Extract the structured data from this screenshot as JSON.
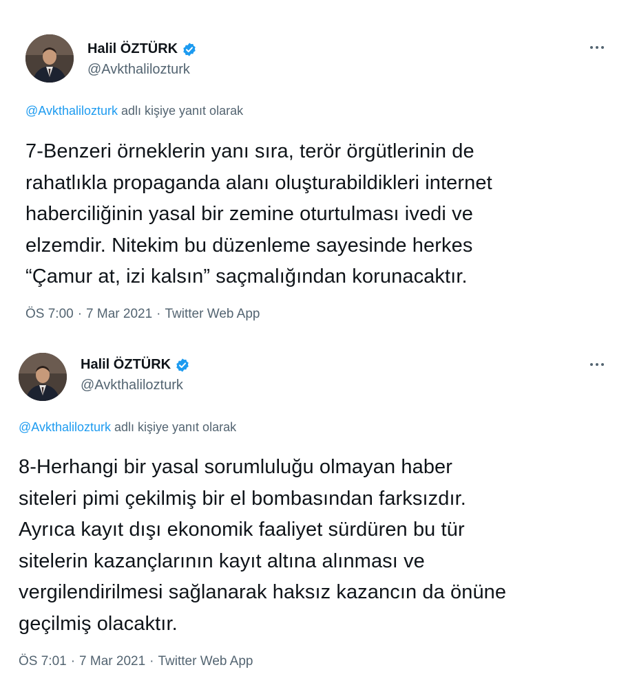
{
  "tweets": [
    {
      "author_name": "Halil ÖZTÜRK",
      "author_handle": "@Avkthalilozturk",
      "reply_mention": "@Avkthalilozturk",
      "reply_suffix": " adlı kişiye yanıt olarak",
      "text_lines": [
        "7-Benzeri örneklerin yanı sıra, terör örgütlerinin de",
        "rahatlıkla propaganda alanı oluşturabildikleri internet",
        "haberciliğinin yasal bir zemine oturtulması ivedi ve",
        "elzemdir. Nitekim bu düzenleme sayesinde herkes",
        "“Çamur at, izi kalsın” saçmalığından korunacaktır."
      ],
      "time": "ÖS 7:00",
      "date": "7 Mar 2021",
      "source": "Twitter Web App"
    },
    {
      "author_name": "Halil ÖZTÜRK",
      "author_handle": "@Avkthalilozturk",
      "reply_mention": "@Avkthalilozturk",
      "reply_suffix": " adlı kişiye yanıt olarak",
      "text_lines": [
        "8-Herhangi bir yasal sorumluluğu olmayan haber",
        "siteleri pimi çekilmiş bir el bombasından farksızdır.",
        "Ayrıca kayıt dışı ekonomik faaliyet sürdüren bu tür",
        "sitelerin kazançlarının kayıt altına alınması ve",
        "vergilendirilmesi sağlanarak haksız kazancın da önüne",
        "geçilmiş olacaktır."
      ],
      "time": "ÖS 7:01",
      "date": "7 Mar 2021",
      "source": "Twitter Web App"
    }
  ],
  "separator": "·",
  "icons": {
    "verified": "verified-badge-icon",
    "more": "more-options-icon"
  },
  "colors": {
    "text": "#0f1419",
    "secondary": "#536471",
    "accent": "#1d9bf0"
  }
}
